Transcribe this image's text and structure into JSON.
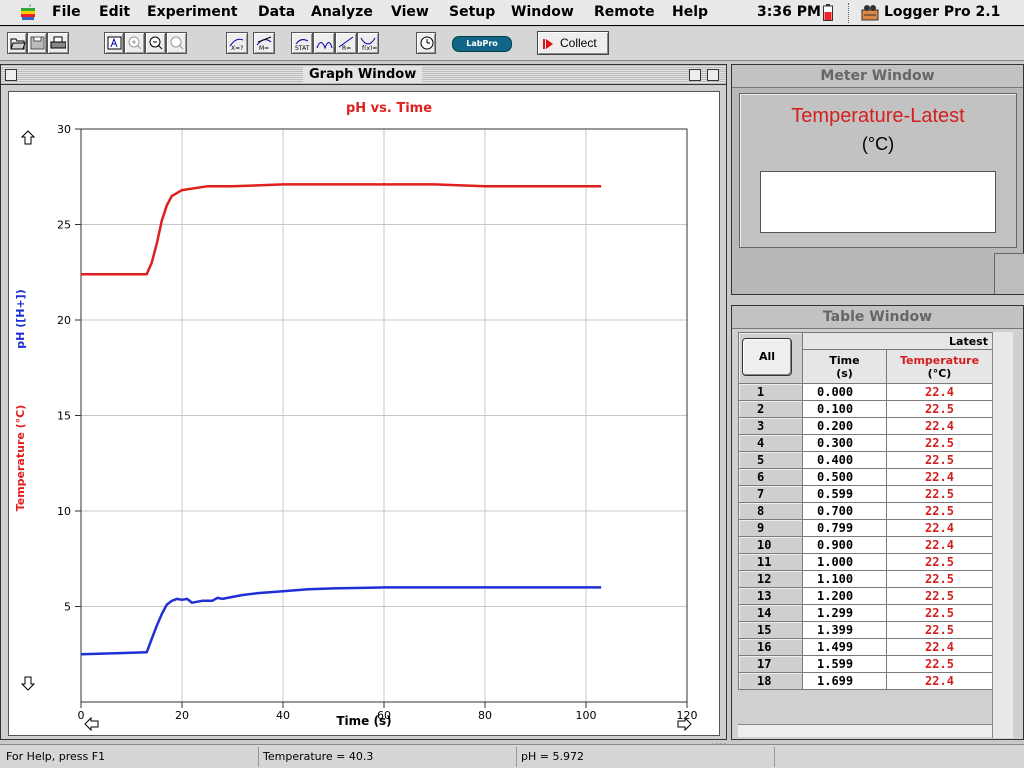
{
  "menubar": {
    "apple_icon": "apple-logo-icon",
    "items": [
      "File",
      "Edit",
      "Experiment",
      "Data",
      "Analyze",
      "View",
      "Setup",
      "Window",
      "Remote",
      "Help"
    ],
    "clock": "3:36 PM",
    "app_name": "Logger Pro 2.1"
  },
  "toolbar": {
    "icons": [
      "open-folder-icon",
      "save-disk-icon",
      "print-icon",
      "autoscale-icon",
      "zoom-in-icon",
      "zoom-out-icon",
      "zoom-icon",
      "examine-icon",
      "tangent-icon",
      "statistics-icon",
      "integral-icon",
      "linear-fit-icon",
      "curve-fit-icon",
      "clock-icon",
      "labpro-icon"
    ],
    "labpro_label": "LabPro",
    "collect_label": "Collect"
  },
  "graph_window": {
    "title": "Graph Window",
    "chart_title": "pH vs. Time"
  },
  "chart_data": {
    "type": "line",
    "title": "pH vs. Time",
    "xlabel": "Time (s)",
    "ylabel_top": "pH ([H+])",
    "ylabel_bottom": "Temperature (°C)",
    "xlim": [
      0,
      120
    ],
    "ylim": [
      0,
      30
    ],
    "x_ticks": [
      0,
      20,
      40,
      60,
      80,
      100,
      120
    ],
    "y_ticks": [
      5,
      10,
      15,
      20,
      25,
      30
    ],
    "grid": true,
    "series": [
      {
        "name": "Temperature",
        "color": "#e01f1f",
        "points": [
          [
            0,
            22.4
          ],
          [
            13,
            22.4
          ],
          [
            14,
            23.0
          ],
          [
            15,
            24.0
          ],
          [
            16,
            25.2
          ],
          [
            17,
            26.0
          ],
          [
            18,
            26.5
          ],
          [
            20,
            26.8
          ],
          [
            25,
            27.0
          ],
          [
            30,
            27.0
          ],
          [
            40,
            27.1
          ],
          [
            50,
            27.1
          ],
          [
            60,
            27.1
          ],
          [
            70,
            27.1
          ],
          [
            80,
            27.0
          ],
          [
            90,
            27.0
          ],
          [
            103,
            27.0
          ]
        ]
      },
      {
        "name": "pH",
        "color": "#1f2fd6",
        "points": [
          [
            0,
            2.5
          ],
          [
            13,
            2.6
          ],
          [
            14,
            3.3
          ],
          [
            15,
            4.0
          ],
          [
            16,
            4.6
          ],
          [
            17,
            5.1
          ],
          [
            18,
            5.3
          ],
          [
            19,
            5.4
          ],
          [
            20,
            5.35
          ],
          [
            21,
            5.4
          ],
          [
            22,
            5.2
          ],
          [
            24,
            5.3
          ],
          [
            26,
            5.3
          ],
          [
            27,
            5.45
          ],
          [
            28,
            5.4
          ],
          [
            30,
            5.5
          ],
          [
            32,
            5.6
          ],
          [
            35,
            5.7
          ],
          [
            40,
            5.8
          ],
          [
            45,
            5.9
          ],
          [
            50,
            5.95
          ],
          [
            60,
            6.0
          ],
          [
            80,
            6.0
          ],
          [
            103,
            6.0
          ]
        ]
      }
    ]
  },
  "meter_window": {
    "title": "Meter Window",
    "sensor_name": "Temperature-Latest",
    "unit": "(°C)",
    "value": ""
  },
  "table_window": {
    "title": "Table Window",
    "all_label": "All",
    "set_name": "Latest",
    "columns": [
      {
        "name": "Time",
        "unit": "(s)"
      },
      {
        "name": "Temperature",
        "unit": "(°C)"
      }
    ],
    "rows": [
      [
        "1",
        "0.000",
        "22.4"
      ],
      [
        "2",
        "0.100",
        "22.5"
      ],
      [
        "3",
        "0.200",
        "22.4"
      ],
      [
        "4",
        "0.300",
        "22.5"
      ],
      [
        "5",
        "0.400",
        "22.5"
      ],
      [
        "6",
        "0.500",
        "22.4"
      ],
      [
        "7",
        "0.599",
        "22.5"
      ],
      [
        "8",
        "0.700",
        "22.5"
      ],
      [
        "9",
        "0.799",
        "22.4"
      ],
      [
        "10",
        "0.900",
        "22.4"
      ],
      [
        "11",
        "1.000",
        "22.5"
      ],
      [
        "12",
        "1.100",
        "22.5"
      ],
      [
        "13",
        "1.200",
        "22.5"
      ],
      [
        "14",
        "1.299",
        "22.5"
      ],
      [
        "15",
        "1.399",
        "22.5"
      ],
      [
        "16",
        "1.499",
        "22.4"
      ],
      [
        "17",
        "1.599",
        "22.5"
      ],
      [
        "18",
        "1.699",
        "22.4"
      ]
    ]
  },
  "statusbar": {
    "help": "For Help, press F1",
    "temperature": "Temperature = 40.3",
    "ph": "pH = 5.972"
  }
}
